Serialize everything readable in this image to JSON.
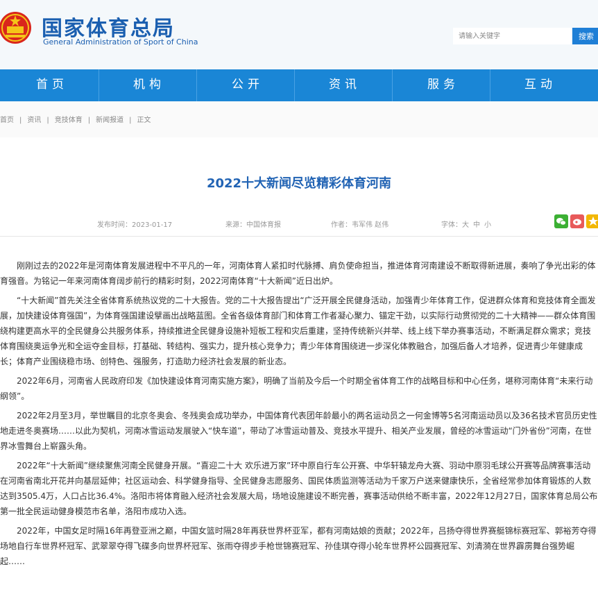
{
  "site": {
    "title_cn": "国家体育总局",
    "title_en": "General Administration of Sport of China"
  },
  "search": {
    "placeholder": "请输入关键字",
    "button": "搜索"
  },
  "nav": {
    "items": [
      "首页",
      "机构",
      "公开",
      "资讯",
      "服务",
      "互动"
    ]
  },
  "breadcrumb": [
    "首页",
    "资讯",
    "竞技体育",
    "新闻报道",
    "正文"
  ],
  "article": {
    "title": "2022十大新闻尽览精彩体育河南",
    "publish_label": "发布时间：",
    "publish_date": "2023-01-17",
    "source_label": "来源：",
    "source": "中国体育报",
    "author_label": "作者：",
    "author": "韦军伟 赵伟",
    "font_label": "字体：",
    "font_large": "大",
    "font_medium": "中",
    "font_small": "小",
    "paragraphs": [
      "刚刚过去的2022年是河南体育发展进程中不平凡的一年，河南体育人紧扣时代脉搏、肩负使命担当，推进体育河南建设不断取得新进展，奏响了争光出彩的体育强音。为铭记一年来河南体育阔步前行的精彩时刻，2022河南体育“十大新闻”近日出炉。",
      "“十大新闻”首先关注全省体育系统热议党的二十大报告。党的二十大报告提出“广泛开展全民健身活动，加强青少年体育工作，促进群众体育和竞技体育全面发展，加快建设体育强国”，为体育强国建设擘画出战略蓝图。全省各级体育部门和体育工作者凝心聚力、锚定干劲，以实际行动贯彻党的二十大精神——群众体育围绕构建更高水平的全民健身公共服务体系，持续推进全民健身设施补短板工程和灾后重建，坚持传统新兴并举、线上线下举办赛事活动，不断满足群众需求；竞技体育围绕奥运争光和全运夺金目标，打基础、转结构、强实力，提升核心竞争力；青少年体育围绕进一步深化体教融合，加强后备人才培养，促进青少年健康成长；体育产业围绕稳市场、创特色、强服务，打造助力经济社会发展的新业态。",
      "2022年6月，河南省人民政府印发《加快建设体育河南实施方案》，明确了当前及今后一个时期全省体育工作的战略目标和中心任务，堪称河南体育“未来行动纲领”。",
      "2022年2月至3月，举世瞩目的北京冬奥会、冬残奥会成功举办，中国体育代表团年龄最小的两名运动员之一何金博等5名河南运动员以及36名技术官员历史性地走进冬奥赛场……以此为契机，河南冰雪运动发展驶入“快车道”，带动了冰雪运动普及、竞技水平提升、相关产业发展，曾经的冰雪运动“门外省份”河南，在世界冰雪舞台上崭露头角。",
      "2022年“十大新闻”继续聚焦河南全民健身开展。“喜迎二十大 欢乐进万家”环中原自行车公开赛、中华轩辕龙舟大赛、羽动中原羽毛球公开赛等品牌赛事活动在河南省南北开花并向基层延伸；社区运动会、科学健身指导、全民健身志愿服务、国民体质监测等活动为千家万户送来健康快乐，全省经常参加体育锻炼的人数达到3505.4万，人口占比36.4%。洛阳市将体育融入经济社会发展大局，场地设施建设不断完善，赛事活动供给不断丰富，2022年12月27日，国家体育总局公布第一批全民运动健身模范市名单，洛阳市成功入选。",
      "2022年，中国女足时隔16年再登亚洲之巅，中国女篮时隔28年再获世界杯亚军，都有河南姑娘的贡献；2022年，吕扬夺得世界赛艇锦标赛冠军、郭裕芳夺得场地自行车世界杯冠军、武翠翠夺得飞碟多向世界杯冠军、张雨夺得步手枪世锦赛冠军、孙佳琪夺得小轮车世界杯公园赛冠军、刘清漪在世界霹雳舞台强势崛起……"
    ]
  },
  "colors": {
    "brand_blue": "#1b5fb0",
    "nav_blue": "#1a86d6",
    "title_blue": "#2163b4",
    "wechat_green": "#3cb034",
    "weibo_red": "#e85a5a",
    "qzone_yellow": "#f2b705"
  },
  "icons": {
    "emblem": "national-emblem-icon",
    "wechat": "wechat-icon",
    "weibo": "weibo-icon",
    "qzone": "qzone-icon"
  }
}
